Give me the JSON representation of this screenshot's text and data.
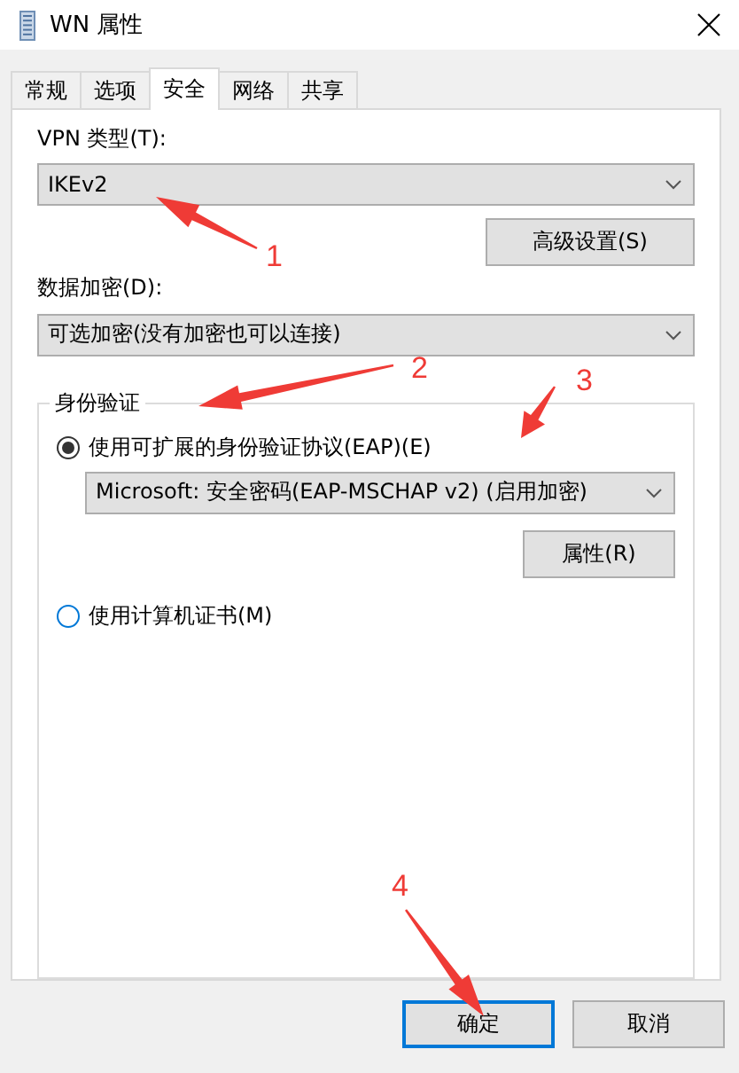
{
  "window": {
    "title": "WN 属性"
  },
  "tabs": [
    {
      "label": "常规",
      "selected": false
    },
    {
      "label": "选项",
      "selected": false
    },
    {
      "label": "安全",
      "selected": true
    },
    {
      "label": "网络",
      "selected": false
    },
    {
      "label": "共享",
      "selected": false
    }
  ],
  "vpn_type": {
    "label": "VPN 类型(T):",
    "value": "IKEv2"
  },
  "advanced_button": "高级设置(S)",
  "encryption": {
    "label": "数据加密(D):",
    "value": "可选加密(没有加密也可以连接)"
  },
  "authentication": {
    "title": "身份验证",
    "options": [
      {
        "label": "使用可扩展的身份验证协议(EAP)(E)",
        "selected": true
      },
      {
        "label": "使用计算机证书(M)",
        "selected": false
      }
    ],
    "eap_method": "Microsoft: 安全密码(EAP-MSCHAP v2) (启用加密)",
    "properties_button": "属性(R)"
  },
  "buttons": [
    {
      "label": "确定",
      "default": true
    },
    {
      "label": "取消",
      "default": false
    }
  ],
  "annotations": [
    {
      "label": "1"
    },
    {
      "label": "2"
    },
    {
      "label": "3"
    },
    {
      "label": "4"
    }
  ]
}
